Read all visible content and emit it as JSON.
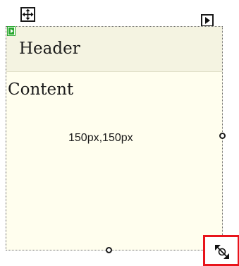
{
  "panel": {
    "header_text": "Header",
    "content_text": "Content",
    "size_readout": "150px,150px"
  },
  "handles": {
    "move_icon": "move-cross-arrows-icon",
    "menu_icon": "chevron-right-icon",
    "resize_icon": "diagonal-resize-icon",
    "marker_icon": "green-play-marker-icon"
  },
  "colors": {
    "panel_background": "#fffeee",
    "header_background": "#f4f3e1",
    "highlight_border": "#e8141b",
    "marker": "#2aa82f"
  }
}
